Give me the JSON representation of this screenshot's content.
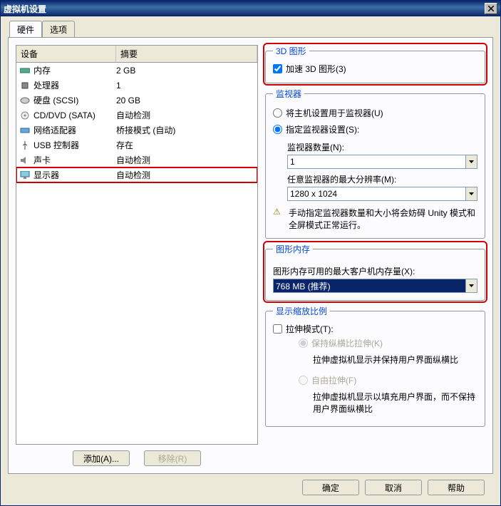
{
  "window": {
    "title": "虚拟机设置"
  },
  "tabs": {
    "hardware": "硬件",
    "options": "选项"
  },
  "list": {
    "col_device": "设备",
    "col_summary": "摘要",
    "rows": [
      {
        "icon": "memory-icon",
        "name": "内存",
        "summary": "2 GB"
      },
      {
        "icon": "cpu-icon",
        "name": "处理器",
        "summary": "1"
      },
      {
        "icon": "disk-icon",
        "name": "硬盘 (SCSI)",
        "summary": "20 GB"
      },
      {
        "icon": "cd-icon",
        "name": "CD/DVD (SATA)",
        "summary": "自动检测"
      },
      {
        "icon": "network-icon",
        "name": "网络适配器",
        "summary": "桥接模式 (自动)"
      },
      {
        "icon": "usb-icon",
        "name": "USB 控制器",
        "summary": "存在"
      },
      {
        "icon": "sound-icon",
        "name": "声卡",
        "summary": "自动检测"
      },
      {
        "icon": "display-icon",
        "name": "显示器",
        "summary": "自动检测"
      }
    ]
  },
  "left_buttons": {
    "add": "添加(A)...",
    "remove": "移除(R)"
  },
  "right": {
    "g3d": {
      "legend": "3D 图形",
      "accel": "加速 3D 图形(3)",
      "accel_checked": true
    },
    "monitors": {
      "legend": "监视器",
      "radio_host": "将主机设置用于监视器(U)",
      "radio_specify": "指定监视器设置(S):",
      "count_label": "监视器数量(N):",
      "count_value": "1",
      "maxres_label": "任意监视器的最大分辨率(M):",
      "maxres_value": "1280 x 1024",
      "warning": "手动指定监视器数量和大小将会妨碍 Unity 模式和全屏模式正常运行。"
    },
    "gmem": {
      "legend": "图形内存",
      "label": "图形内存可用的最大客户机内存量(X):",
      "value": "768 MB (推荐)"
    },
    "scale": {
      "legend": "显示缩放比例",
      "stretch": "拉伸模式(T):",
      "stretch_checked": false,
      "keep_aspect": "保持纵横比拉伸(K)",
      "keep_aspect_hint": "拉伸虚拟机显示并保持用户界面纵横比",
      "free_stretch": "自由拉伸(F)",
      "free_stretch_hint": "拉伸虚拟机显示以填充用户界面，而不保持用户界面纵横比"
    }
  },
  "footer": {
    "ok": "确定",
    "cancel": "取消",
    "help": "帮助"
  }
}
